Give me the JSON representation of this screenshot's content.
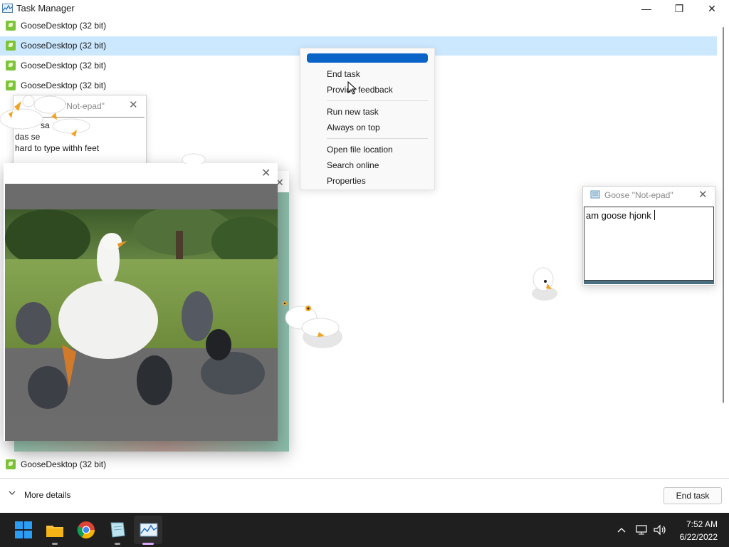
{
  "window": {
    "title": "Task Manager",
    "minimize_glyph": "—",
    "maximize_glyph": "❐",
    "close_glyph": "✕"
  },
  "processes": [
    {
      "label": "GooseDesktop (32 bit)",
      "selected": false
    },
    {
      "label": "GooseDesktop (32 bit)",
      "selected": true
    },
    {
      "label": "GooseDesktop (32 bit)",
      "selected": false
    },
    {
      "label": "GooseDesktop (32 bit)",
      "selected": false
    },
    {
      "label": "GooseDesktop (32 bit)",
      "selected": false
    }
  ],
  "context_menu": {
    "items": [
      "End task",
      "Provide feedback",
      "Run new task",
      "Always on top",
      "Open file location",
      "Search online",
      "Properties"
    ]
  },
  "notepad_small": {
    "title": "\"Not-epad\"",
    "lines": [
      "sa",
      "das        se",
      "hard to type withh feet"
    ]
  },
  "notepad_large": {
    "title": "Goose \"Not-epad\"",
    "text": "am goose hjonk"
  },
  "meme_window": {
    "close_glyph": "✕"
  },
  "footer": {
    "more_details": "More details",
    "end_task": "End task"
  },
  "taskbar": {
    "apps": [
      "start-icon",
      "file-explorer-icon",
      "chrome-icon",
      "notepad-icon",
      "task-manager-icon"
    ],
    "time": "7:52 AM",
    "date": "6/22/2022"
  },
  "colors": {
    "selection": "#cce8ff",
    "menu_highlight": "#0a64c7",
    "taskbar": "#1f1f1f",
    "process_icon": "#7cc43a"
  }
}
